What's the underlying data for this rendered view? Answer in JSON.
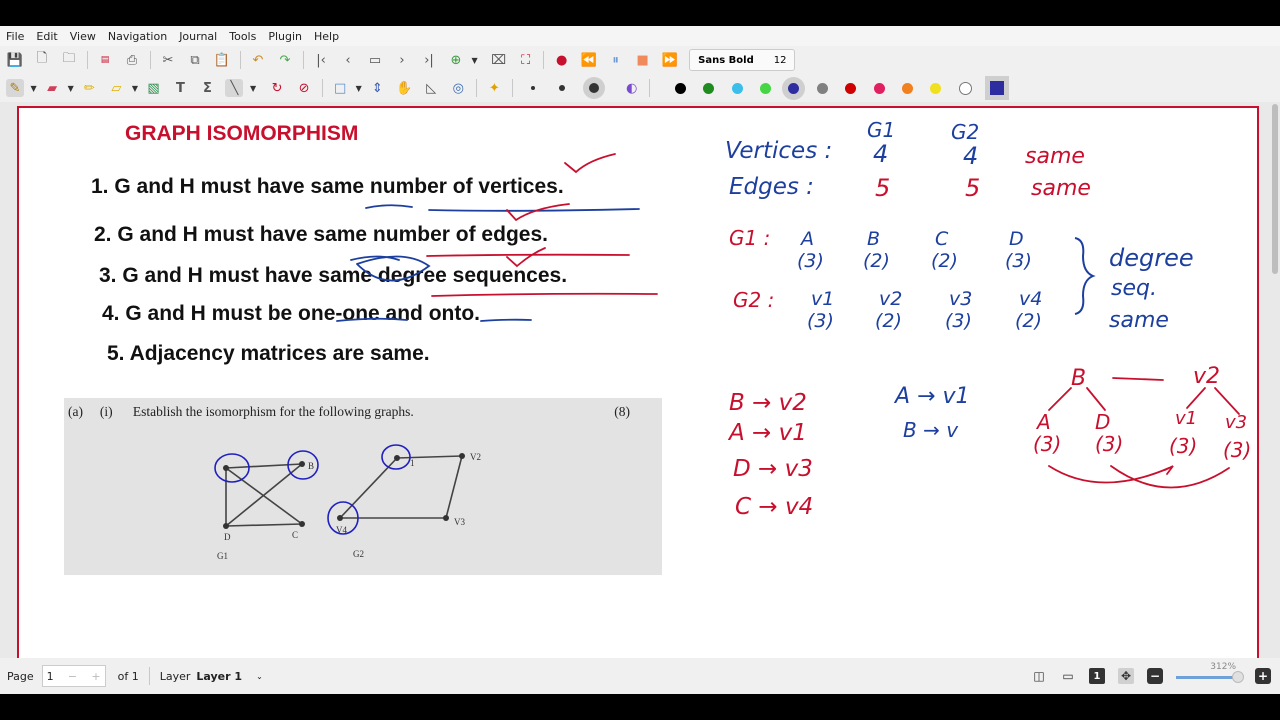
{
  "menu": [
    "File",
    "Edit",
    "View",
    "Navigation",
    "Journal",
    "Tools",
    "Plugin",
    "Help"
  ],
  "font": {
    "name": "Sans Bold",
    "size": "12"
  },
  "colors": {
    "accent_red": "#c8102e",
    "ink_blue": "#1d3f9e",
    "ink_red": "#c8102e",
    "palette": [
      "#000000",
      "#1f8c1f",
      "#3dbdea",
      "#45d545",
      "#2d2da0",
      "#808080",
      "#d00000",
      "#e02060",
      "#f08020",
      "#f0e020",
      "#ffffff"
    ]
  },
  "icons": {
    "toolbar1": [
      "save-icon",
      "new-page-icon",
      "open-icon",
      "export-pdf-icon",
      "print-icon",
      "cut-icon",
      "copy-icon",
      "paste-icon",
      "undo-icon",
      "redo-icon",
      "first-page-icon",
      "previous-page-icon",
      "goto-page-icon",
      "next-page-icon",
      "last-page-icon",
      "new-page-after-icon",
      "delete-page-icon",
      "fullscreen-icon",
      "record-icon",
      "rewind-icon",
      "pause-icon",
      "stop-icon",
      "fast-forward-icon"
    ],
    "toolbar2": [
      "pen-icon",
      "eraser-icon",
      "highlighter-icon",
      "shapes-icon",
      "image-icon",
      "text-icon",
      "tex-icon",
      "line-icon",
      "select-region-icon",
      "select-object-icon",
      "rectangle-icon",
      "vertical-space-icon",
      "hand-icon",
      "ruler-icon",
      "default-tool-icon",
      "laser-icon"
    ]
  },
  "document": {
    "title": "GRAPH ISOMORPHISM",
    "rules": [
      "1. G and H must have same number of vertices.",
      "2. G and H must have same number of edges.",
      "3. G and H must have same degree sequences.",
      "4. G and H must be one-one and onto.",
      "5. Adjacency matrices are same."
    ],
    "question": {
      "label_a": "(a)",
      "label_i": "(i)",
      "text": "Establish the isomorphism for the following graphs.",
      "marks": "(8)",
      "g1_label": "G1",
      "g2_label": "G2",
      "g1_vertices": [
        "D",
        "C",
        "B"
      ],
      "g2_vertices": [
        "1",
        "V2",
        "V3",
        "V4"
      ]
    },
    "notes": {
      "col_g1": "G1",
      "col_g2": "G2",
      "vertices_label": "Vertices :",
      "vertices_g1": "4",
      "vertices_g2": "4",
      "vertices_result": "same",
      "edges_label": "Edges :",
      "edges_g1": "5",
      "edges_g2": "5",
      "edges_result": "same",
      "g1_row_label": "G1 :",
      "g1_names": [
        "A",
        "B",
        "C",
        "D"
      ],
      "g1_degrees": [
        "(3)",
        "(2)",
        "(2)",
        "(3)"
      ],
      "g2_row_label": "G2 :",
      "g2_names": [
        "v1",
        "v2",
        "v3",
        "v4"
      ],
      "g2_degrees": [
        "(3)",
        "(2)",
        "(3)",
        "(2)"
      ],
      "degree_note": [
        "degree",
        "seq.",
        "same"
      ],
      "mapping_left": [
        "B → v2",
        "A → v1",
        "D → v3",
        "C → v4"
      ],
      "mapping_right": [
        "A → v1",
        "B → v"
      ],
      "tree_left": {
        "root": "B",
        "children": [
          "A",
          "D"
        ],
        "degrees": [
          "(3)",
          "(3)"
        ]
      },
      "tree_right": {
        "root": "v2",
        "children": [
          "v1",
          "v3"
        ],
        "degrees": [
          "(3)",
          "(3)"
        ]
      }
    }
  },
  "status": {
    "page_label": "Page",
    "page_value": "1",
    "of_label": "of 1",
    "layer_label": "Layer",
    "layer_value": "Layer 1",
    "zoom": "312%"
  }
}
